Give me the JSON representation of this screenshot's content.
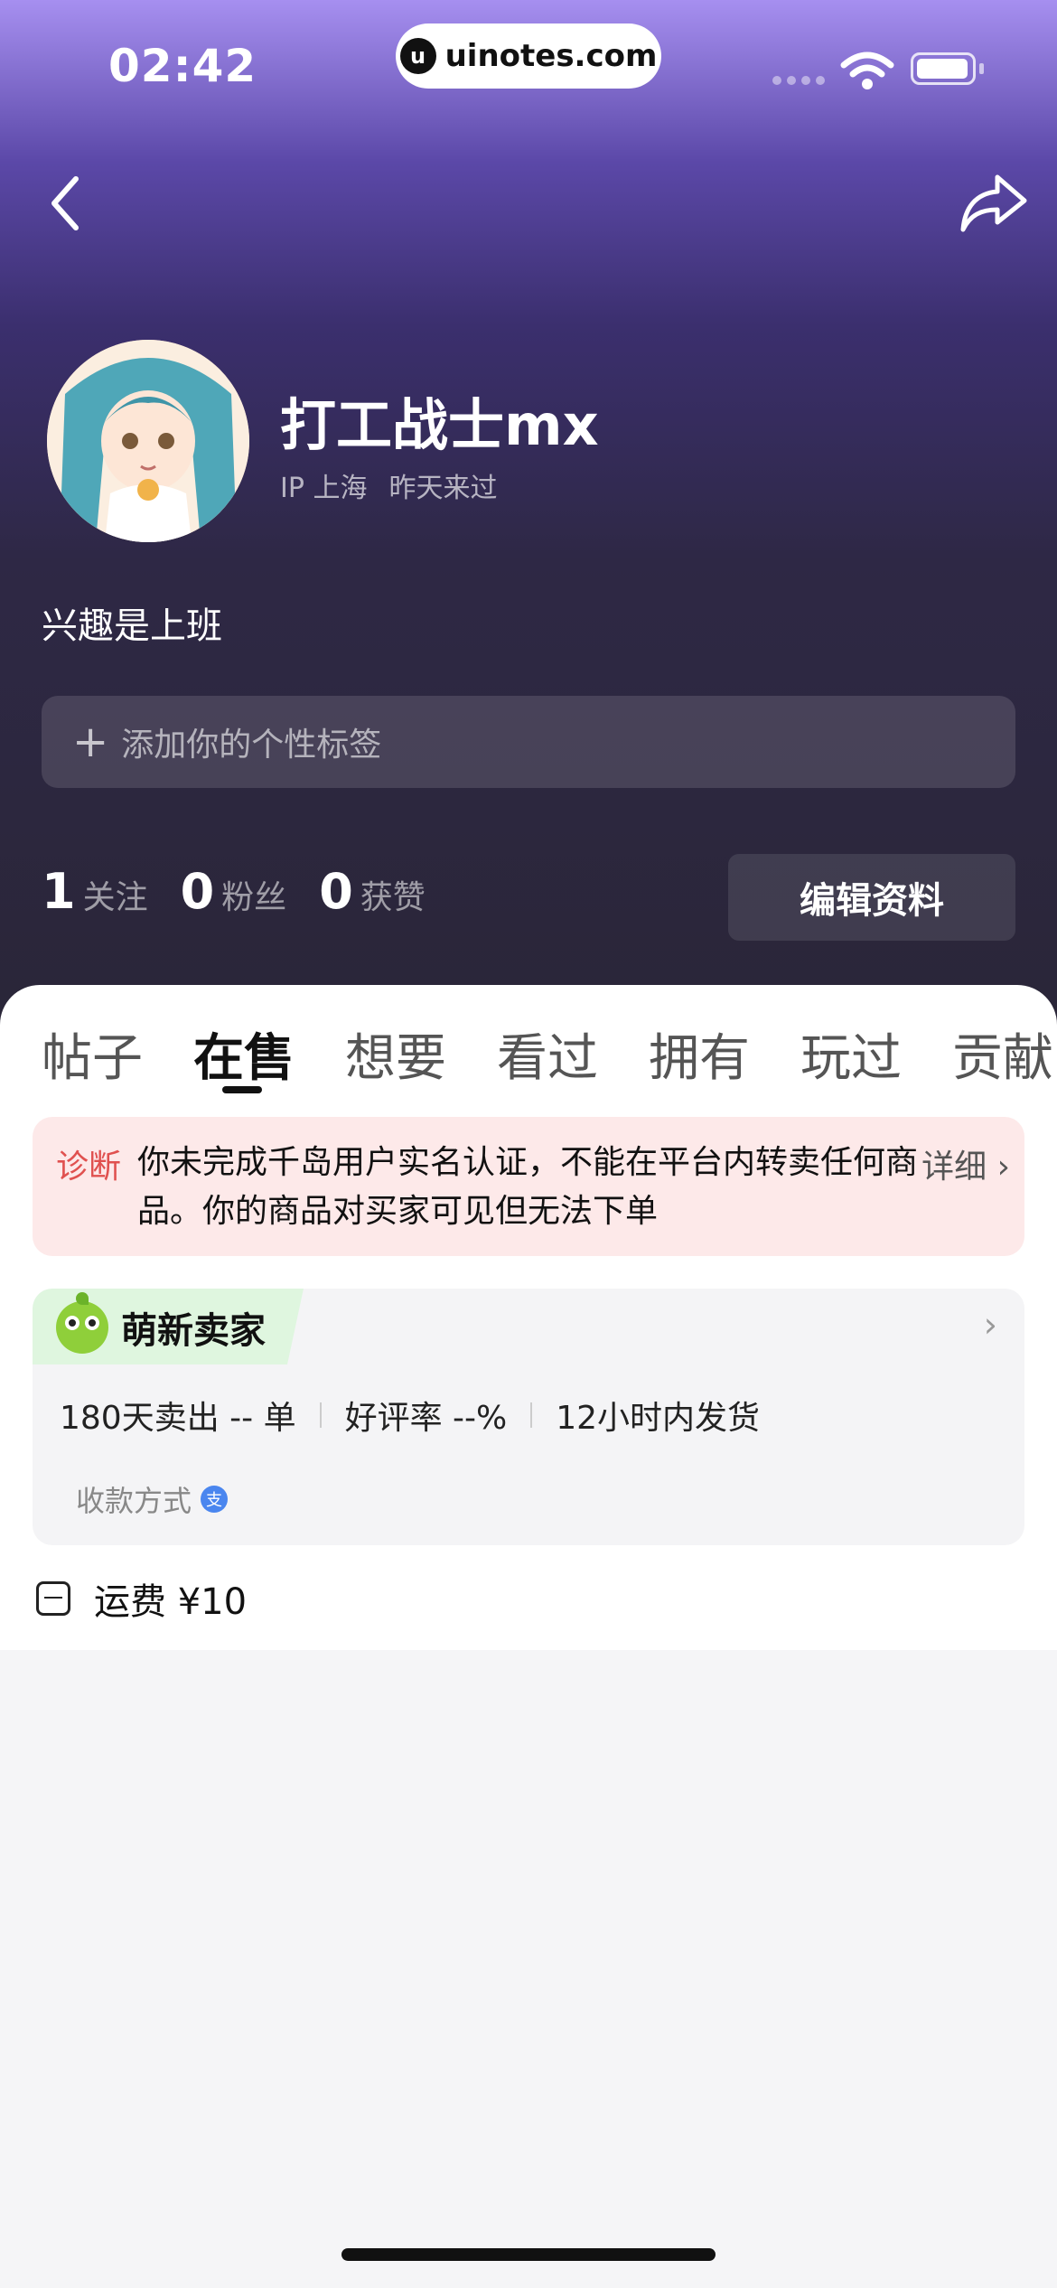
{
  "status_bar": {
    "time": "02:42",
    "watermark": "uinotes.com",
    "watermark_logo": "u"
  },
  "profile": {
    "username": "打工战士mx",
    "ip_location": "IP 上海",
    "last_seen": "昨天来过",
    "bio": "兴趣是上班",
    "tag_placeholder": "添加你的个性标签",
    "tag_plus": "+",
    "stats": [
      {
        "count": "1",
        "label": "关注"
      },
      {
        "count": "0",
        "label": "粉丝"
      },
      {
        "count": "0",
        "label": "获赞"
      }
    ],
    "edit_label": "编辑资料"
  },
  "tabs": [
    {
      "label": "帖子",
      "active": false
    },
    {
      "label": "在售",
      "active": true
    },
    {
      "label": "想要",
      "active": false
    },
    {
      "label": "看过",
      "active": false
    },
    {
      "label": "拥有",
      "active": false
    },
    {
      "label": "玩过",
      "active": false
    },
    {
      "label": "贡献",
      "active": false
    }
  ],
  "diagnosis": {
    "label": "诊断",
    "text": "你未完成千岛用户实名认证，不能在平台内转卖任何商品。你的商品对买家可见但无法下单",
    "more": "详细 ›"
  },
  "seller": {
    "title": "萌新卖家",
    "arrow": "›",
    "stats": [
      "180天卖出 -- 单",
      "好评率 --%",
      "12小时内发货"
    ],
    "payment_label": "收款方式",
    "payment_icon_text": "支"
  },
  "shipping": {
    "text": "运费 ¥10"
  },
  "icons": {
    "back": "chevron-left-icon",
    "share": "share-arrow-icon",
    "wifi": "wifi-icon",
    "battery": "battery-icon"
  },
  "colors": {
    "header_top": "#a68ff0",
    "header_bottom": "#2a2638",
    "diagnosis_bg": "#fde9e9",
    "diagnosis_label": "#e0514f",
    "seller_badge_bg": "#dff6df"
  }
}
